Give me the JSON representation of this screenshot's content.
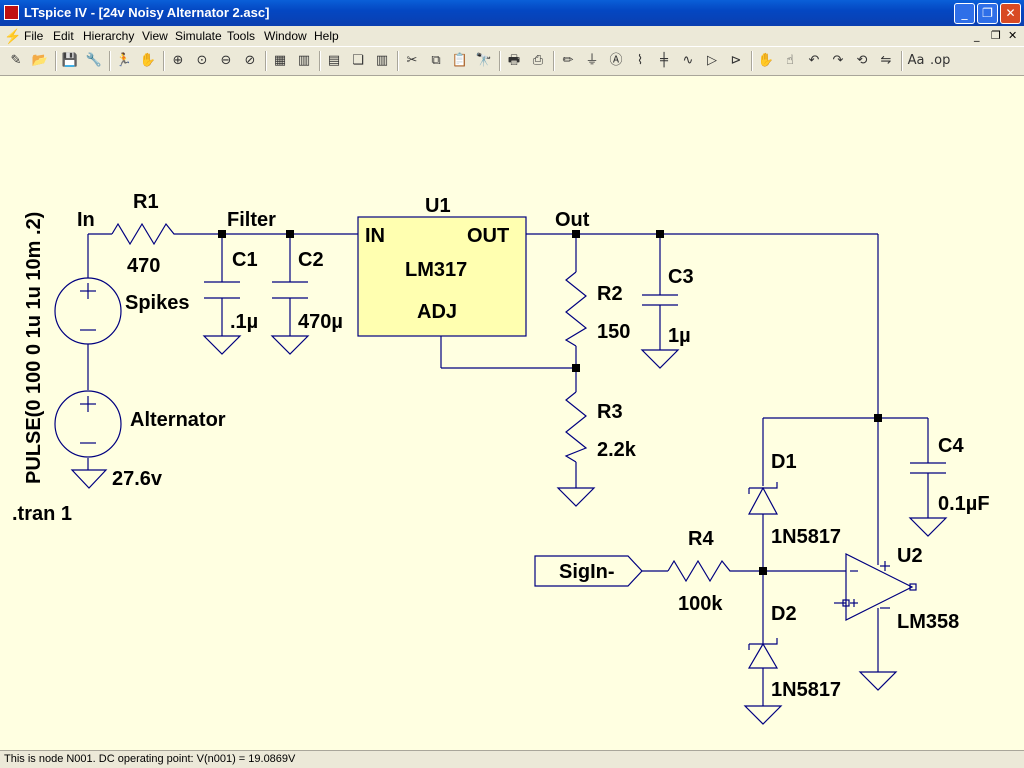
{
  "window": {
    "title": "LTspice IV - [24v Noisy Alternator 2.asc]",
    "minimize_glyph": "_",
    "maximize_glyph": "❐",
    "close_glyph": "✕"
  },
  "menu": {
    "items": [
      "File",
      "Edit",
      "Hierarchy",
      "View",
      "Simulate",
      "Tools",
      "Window",
      "Help"
    ],
    "mdi_min": "_",
    "mdi_restore": "❐",
    "mdi_close": "✕"
  },
  "toolbar": {
    "buttons": [
      {
        "icon": "new-schematic-icon",
        "glyph": "✎"
      },
      {
        "icon": "open-icon",
        "glyph": "📂"
      },
      {
        "icon": "save-icon",
        "glyph": "💾"
      },
      {
        "icon": "control-panel-icon",
        "glyph": "🔧"
      },
      {
        "icon": "run-icon",
        "glyph": "🏃"
      },
      {
        "icon": "halt-icon",
        "glyph": "✋"
      },
      {
        "icon": "zoom-in-icon",
        "glyph": "⊕"
      },
      {
        "icon": "pan-icon",
        "glyph": "⊙"
      },
      {
        "icon": "zoom-out-icon",
        "glyph": "⊖"
      },
      {
        "icon": "zoom-cancel-icon",
        "glyph": "⊘"
      },
      {
        "icon": "autorange-icon",
        "glyph": "▦"
      },
      {
        "icon": "vertical-autorange-icon",
        "glyph": "▥"
      },
      {
        "icon": "tile-horizontal-icon",
        "glyph": "▤"
      },
      {
        "icon": "cascade-icon",
        "glyph": "❏"
      },
      {
        "icon": "tile-vertical-icon",
        "glyph": "▥"
      },
      {
        "icon": "cut-icon",
        "glyph": "✂"
      },
      {
        "icon": "copy-icon",
        "glyph": "⧉"
      },
      {
        "icon": "paste-icon",
        "glyph": "📋"
      },
      {
        "icon": "find-icon",
        "glyph": "🔭"
      },
      {
        "icon": "print-setup-icon",
        "glyph": "🖶"
      },
      {
        "icon": "print-icon",
        "glyph": "⎙"
      },
      {
        "icon": "draw-wire-icon",
        "glyph": "✏"
      },
      {
        "icon": "ground-icon",
        "glyph": "⏚"
      },
      {
        "icon": "label-net-icon",
        "glyph": "Ⓐ"
      },
      {
        "icon": "resistor-icon",
        "glyph": "⌇"
      },
      {
        "icon": "capacitor-icon",
        "glyph": "╪"
      },
      {
        "icon": "inductor-icon",
        "glyph": "∿"
      },
      {
        "icon": "diode-icon",
        "glyph": "▷"
      },
      {
        "icon": "component-icon",
        "glyph": "⊳"
      },
      {
        "icon": "move-icon",
        "glyph": "✋"
      },
      {
        "icon": "drag-icon",
        "glyph": "☝"
      },
      {
        "icon": "undo-icon",
        "glyph": "↶"
      },
      {
        "icon": "redo-icon",
        "glyph": "↷"
      },
      {
        "icon": "rotate-icon",
        "glyph": "⟲"
      },
      {
        "icon": "mirror-icon",
        "glyph": "⇋"
      },
      {
        "icon": "text-icon",
        "glyph": "Aa"
      },
      {
        "icon": "spice-directive-icon",
        "glyph": ".op"
      }
    ]
  },
  "schematic": {
    "nets": {
      "in": "In",
      "filter": "Filter",
      "out": "Out"
    },
    "R1": {
      "ref": "R1",
      "value": "470"
    },
    "C1": {
      "ref": "C1",
      "value": ".1µ"
    },
    "C2": {
      "ref": "C2",
      "value": "470µ"
    },
    "U1": {
      "ref": "U1",
      "part": "LM317",
      "pin_in": "IN",
      "pin_out": "OUT",
      "pin_adj": "ADJ"
    },
    "R2": {
      "ref": "R2",
      "value": "150"
    },
    "C3": {
      "ref": "C3",
      "value": "1µ"
    },
    "R3": {
      "ref": "R3",
      "value": "2.2k"
    },
    "C4": {
      "ref": "C4",
      "value": "0.1µF"
    },
    "D1": {
      "ref": "D1",
      "value": "1N5817"
    },
    "D2": {
      "ref": "D2",
      "value": "1N5817"
    },
    "R4": {
      "ref": "R4",
      "value": "100k"
    },
    "U2": {
      "ref": "U2",
      "part": "LM358"
    },
    "sigin": "SigIn-",
    "V1": {
      "name": "Spikes",
      "value": "PULSE(0 100 0 1u 1u 10m .2)"
    },
    "V2": {
      "name": "Alternator",
      "value": "27.6v"
    },
    "directive": ".tran 1",
    "plus_sign": "+",
    "minus_sign": "−"
  },
  "status": {
    "text": "This is node N001.  DC operating point: V(n001) = 19.0869V"
  },
  "colors": {
    "wire": "#000080",
    "component_fill": "#ffffb0",
    "canvas": "#ffffe1"
  }
}
